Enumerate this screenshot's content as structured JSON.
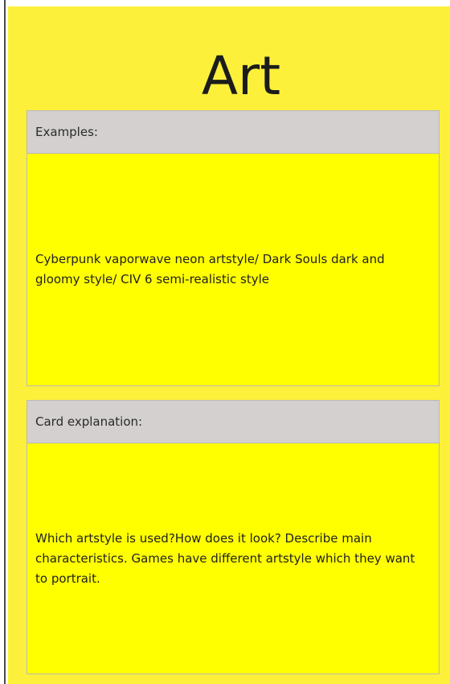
{
  "card": {
    "title": "Art",
    "examples": {
      "header": "Examples:",
      "body": "Cyberpunk vaporwave neon artstyle/ Dark Souls dark and gloomy style/ CIV 6 semi-realistic style"
    },
    "explanation": {
      "header": "Card explanation:",
      "body": "Which artstyle is used?How does it look? Describe main characteristics. Games have different artstyle which they want to portrait."
    }
  },
  "colors": {
    "card_background": "#fdf03a",
    "section_background": "#ffff00",
    "header_background": "#d3d0cf"
  }
}
